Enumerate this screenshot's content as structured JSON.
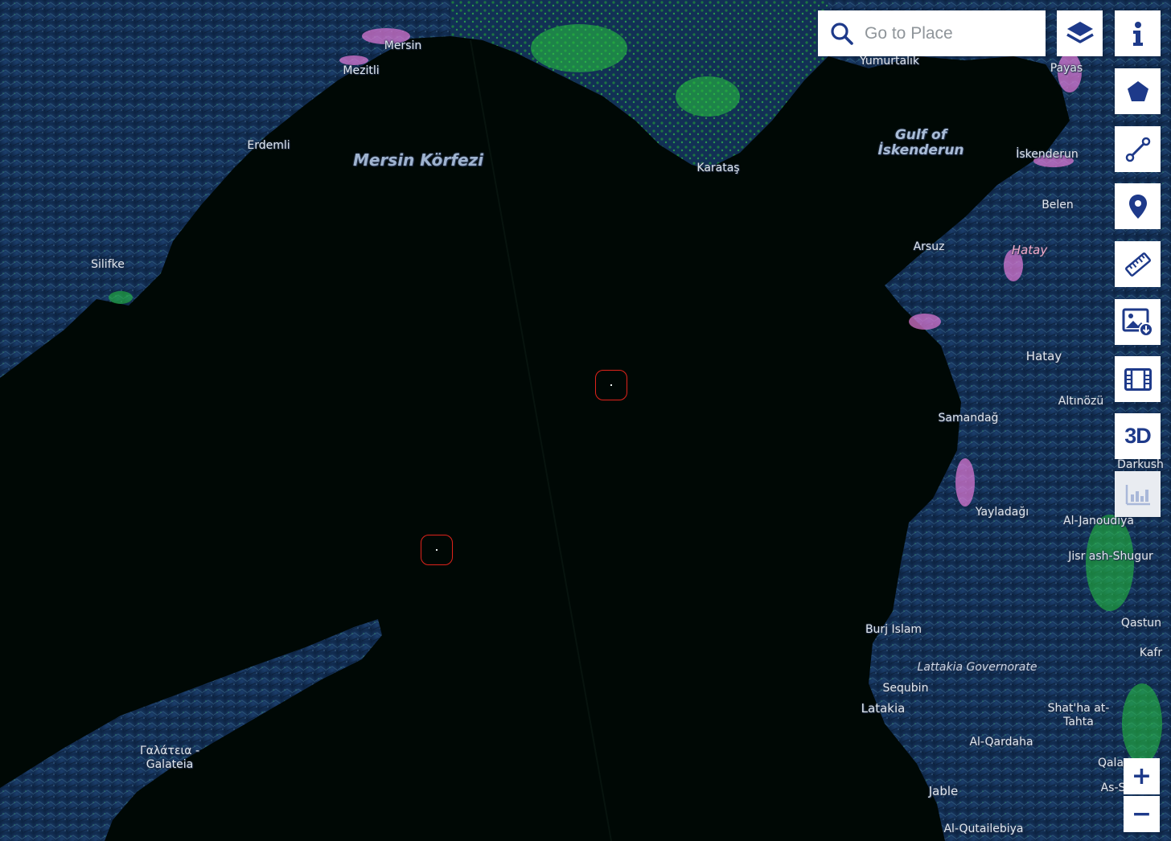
{
  "map": {
    "labels": {
      "mersin": "Mersin",
      "mezitli": "Mezitli",
      "erdemli": "Erdemli",
      "silifke": "Silifke",
      "mersin_korfezi": "Mersin Körfezi",
      "karatas": "Karataş",
      "yumurtalik": "Yumurtalık",
      "payas": "Payas",
      "gulf_of": "Gulf of",
      "iskenderun_gulf": "İskenderun",
      "iskenderun": "İskenderun",
      "belen": "Belen",
      "arsuz": "Arsuz",
      "hatay_region": "Hatay",
      "hatay": "Hatay",
      "samandag": "Samandağ",
      "altinozu": "Altınözü",
      "darkush": "Darkush",
      "yayladagi": "Yayladağı",
      "al_janoudiya": "Al-Janoudiya",
      "jisr_ash_shugur": "Jisr ash-Shugur",
      "burj_islam": "Burj Islam",
      "qastun": "Qastun",
      "kafr": "Kafr",
      "lattakia_governorate": "Lattakia Governorate",
      "sequbin": "Sequbin",
      "latakia": "Latakia",
      "shathaat_1": "Shat'ha at-",
      "shathaat_2": "Tahta",
      "al_qardaha": "Al-Qardaha",
      "qala": "Qala",
      "as_s": "As-S",
      "jable": "Jable",
      "al_qutailebiya": "Al-Qutailebiya",
      "galateia_1": "Γαλάτεια -",
      "galateia_2": "Galateia"
    },
    "colors": {
      "sea": "#000805",
      "land": "#12305a",
      "urban": "#e27ad8",
      "vegetation": "#27c93f",
      "marker": "#e0231b",
      "ui_accent": "#1e3a8a"
    }
  },
  "search": {
    "placeholder": "Go to Place",
    "icon": "search-icon"
  },
  "toolbar": {
    "layers_icon": "layers-icon",
    "info_icon": "info-icon",
    "polygon_icon": "pentagon-icon",
    "line_icon": "line-icon",
    "point_icon": "map-pin-icon",
    "measure_icon": "ruler-icon",
    "download_image_icon": "image-download-icon",
    "timelapse_icon": "film-icon",
    "three_d_label": "3D",
    "stats_icon": "bar-chart-icon"
  },
  "zoom": {
    "in": "+",
    "out": "−"
  },
  "markers": [
    {
      "name": "detected-object-1"
    },
    {
      "name": "detected-object-2"
    }
  ]
}
